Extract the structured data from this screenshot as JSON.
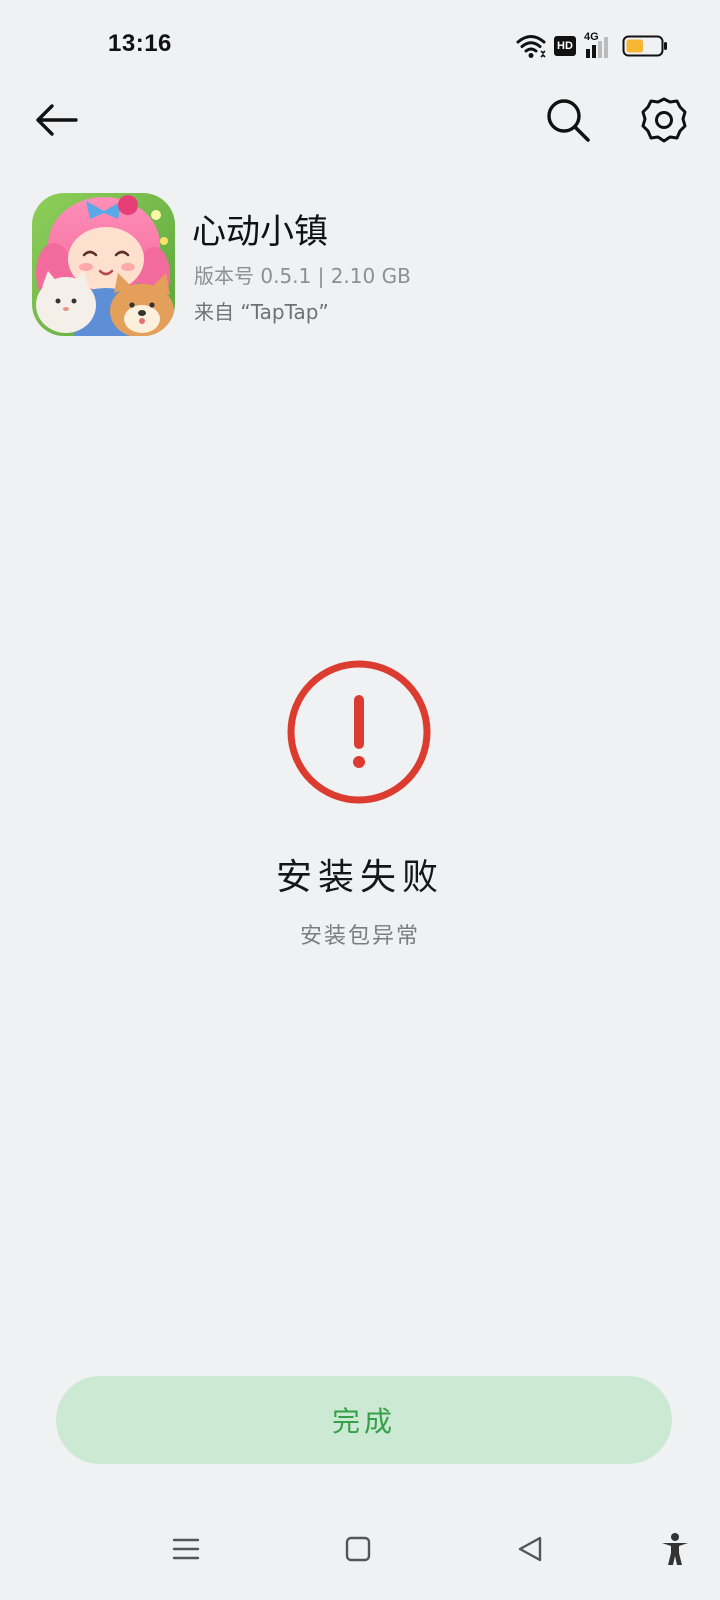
{
  "status_bar": {
    "time": "13:16",
    "icons": [
      "wifi-icon",
      "hd-icon",
      "signal-4g-icon",
      "battery-icon"
    ],
    "hd_label": "HD",
    "network_label": "4G",
    "battery_level": 0.5,
    "battery_color": "#f5b731"
  },
  "top_bar": {
    "back_icon": "back-arrow-icon",
    "search_icon": "search-icon",
    "settings_icon": "gear-icon"
  },
  "app": {
    "name": "心动小镇",
    "version_line": "版本号 0.5.1 | 2.10 GB",
    "source_line": "来自 “TapTap”"
  },
  "result": {
    "icon": "error-exclamation-icon",
    "icon_color": "#dc3b2f",
    "title": "安装失败",
    "subtitle": "安装包异常"
  },
  "done_button": {
    "label": "完成",
    "background": "#cbe9d3",
    "text_color": "#36a149"
  },
  "nav_bar": {
    "icons": [
      "menu-icon",
      "home-icon",
      "back-triangle-icon",
      "accessibility-icon"
    ]
  }
}
